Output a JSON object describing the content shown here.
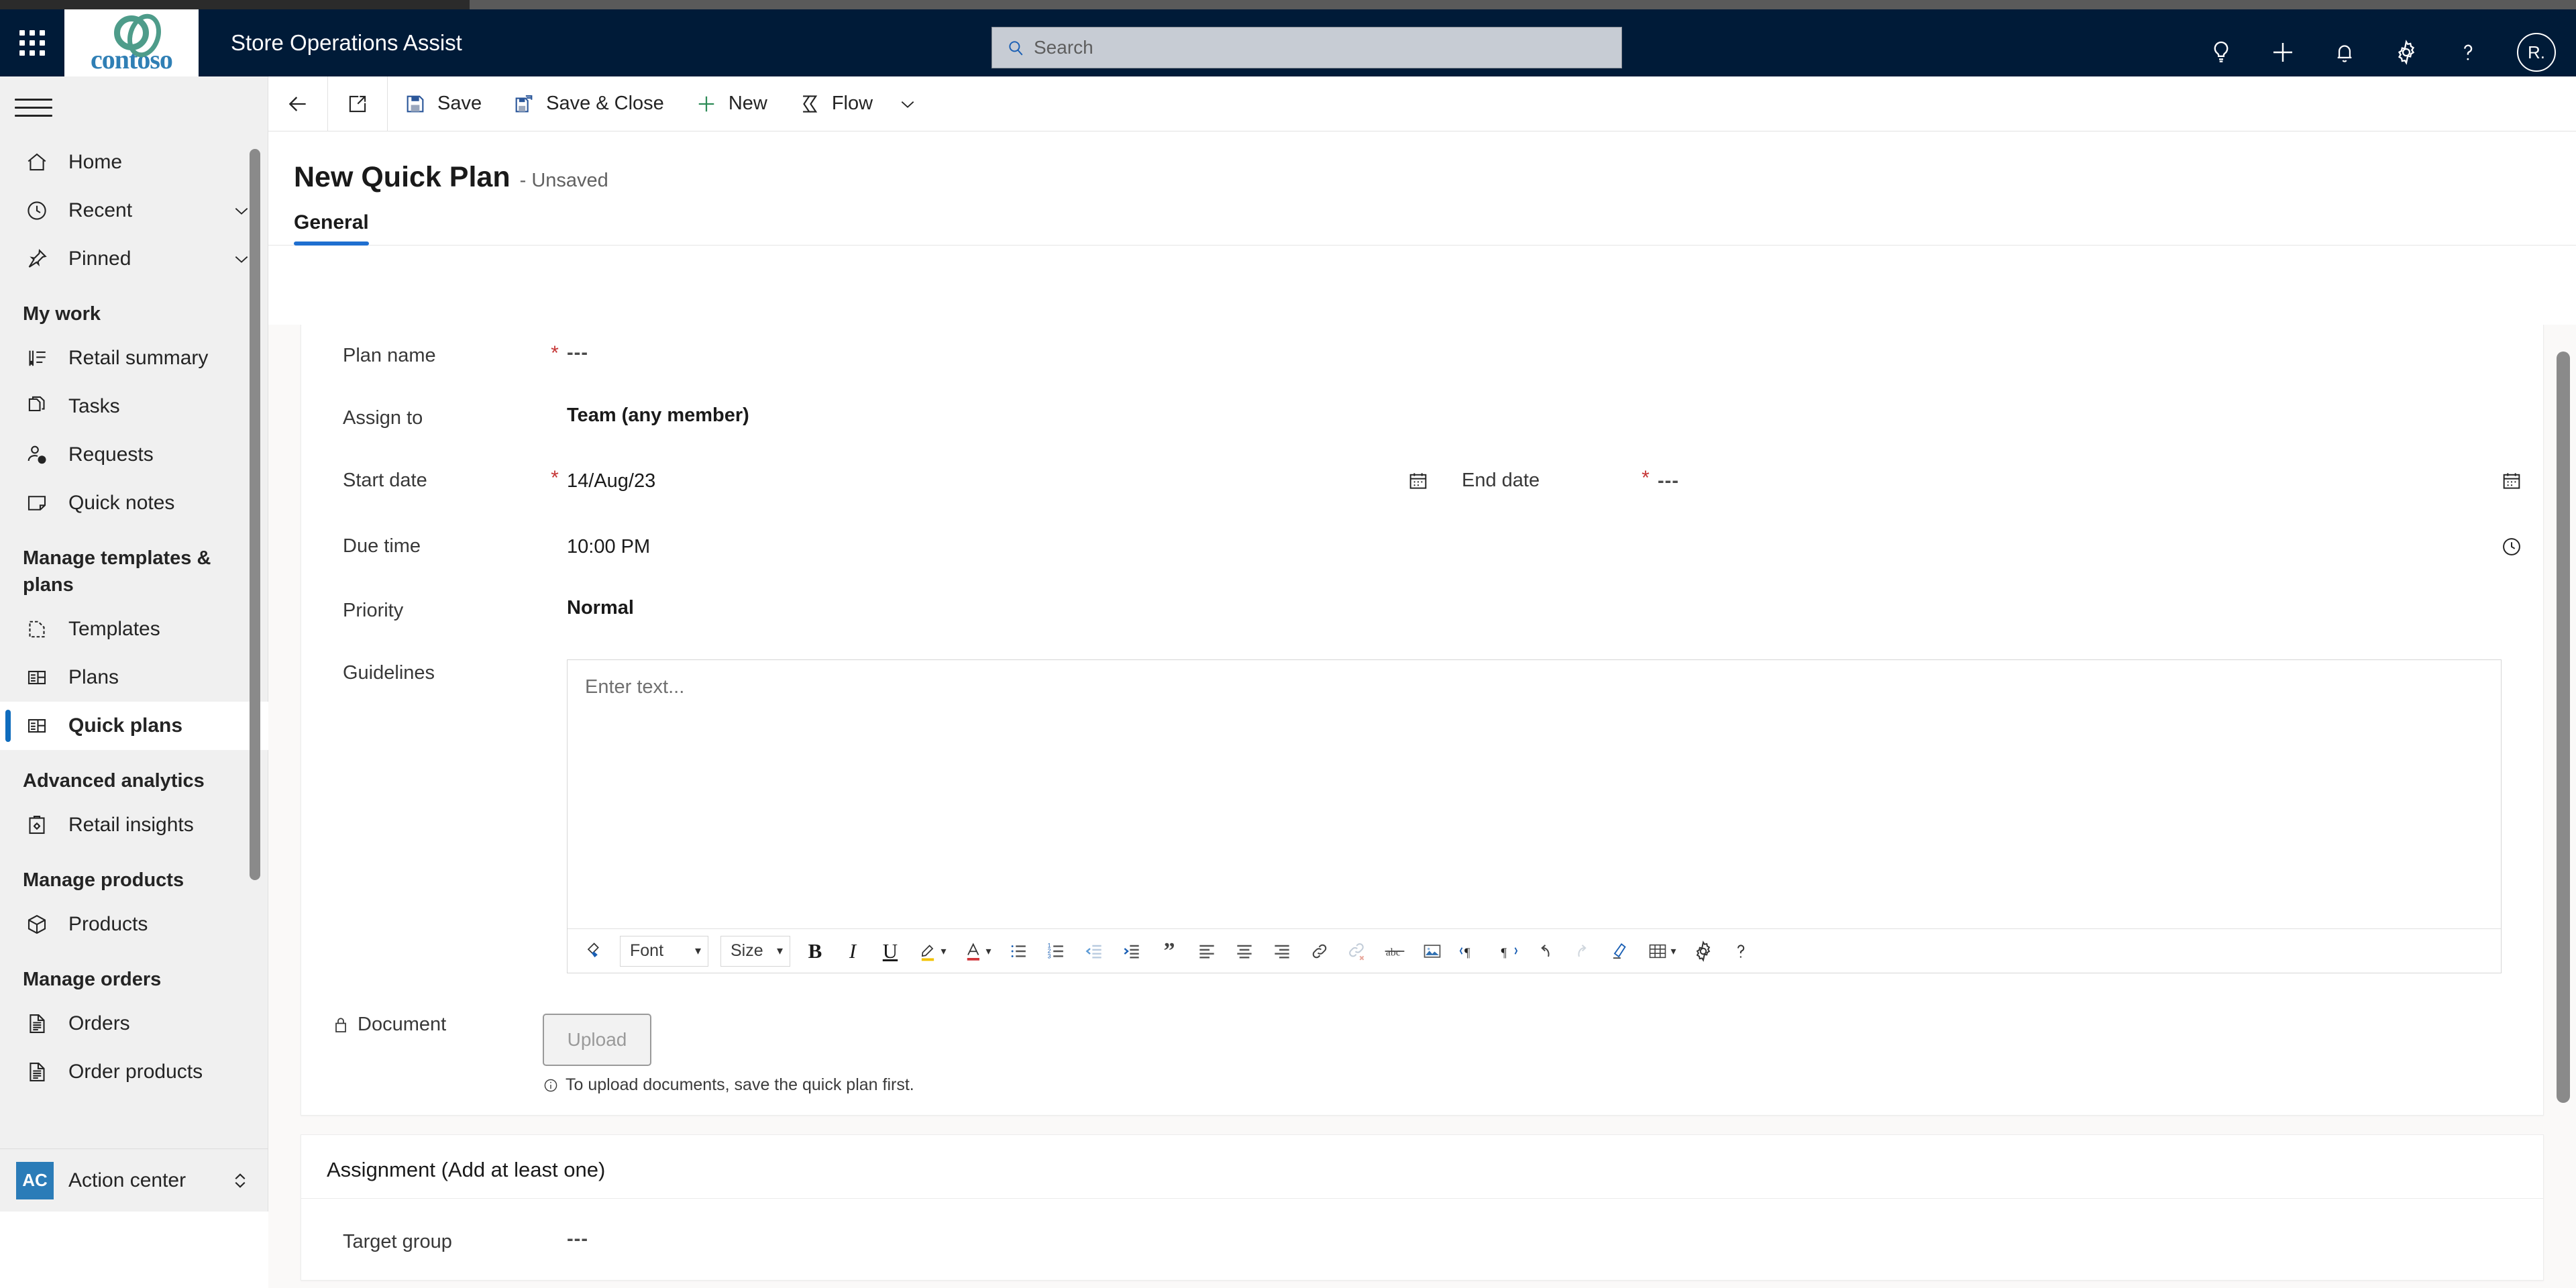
{
  "header": {
    "app_title": "Store Operations Assist",
    "brand_name": "contoso",
    "waffle_label": "App launcher",
    "search": {
      "placeholder": "Search",
      "value": ""
    },
    "actions": [
      {
        "name": "insights-lightbulb-icon",
        "label": "Insights"
      },
      {
        "name": "quick-create-plus-icon",
        "label": "Quick create"
      },
      {
        "name": "notifications-bell-icon",
        "label": "Notifications"
      },
      {
        "name": "settings-gear-icon",
        "label": "Settings"
      },
      {
        "name": "help-question-icon",
        "label": "Help"
      }
    ],
    "avatar_initials": "R."
  },
  "sidebar": {
    "items": [
      {
        "label": "Home",
        "icon": "home-icon",
        "type": "item"
      },
      {
        "label": "Recent",
        "icon": "clock-icon",
        "type": "expand"
      },
      {
        "label": "Pinned",
        "icon": "pin-icon",
        "type": "expand"
      },
      {
        "label": "My work",
        "type": "group"
      },
      {
        "label": "Retail summary",
        "icon": "chart-icon",
        "type": "item"
      },
      {
        "label": "Tasks",
        "icon": "documents-icon",
        "type": "item"
      },
      {
        "label": "Requests",
        "icon": "person-question-icon",
        "type": "item"
      },
      {
        "label": "Quick notes",
        "icon": "note-icon",
        "type": "item"
      },
      {
        "label": "Manage templates & plans",
        "type": "group"
      },
      {
        "label": "Templates",
        "icon": "template-icon",
        "type": "item"
      },
      {
        "label": "Plans",
        "icon": "grid-panel-icon",
        "type": "item"
      },
      {
        "label": "Quick plans",
        "icon": "grid-panel-icon",
        "type": "item",
        "active": true
      },
      {
        "label": "Advanced analytics",
        "type": "group"
      },
      {
        "label": "Retail insights",
        "icon": "clipboard-gear-icon",
        "type": "item"
      },
      {
        "label": "Manage products",
        "type": "group"
      },
      {
        "label": "Products",
        "icon": "box-icon",
        "type": "item"
      },
      {
        "label": "Manage orders",
        "type": "group"
      },
      {
        "label": "Orders",
        "icon": "order-doc-icon",
        "type": "item"
      },
      {
        "label": "Order products",
        "icon": "order-doc-icon",
        "type": "item"
      }
    ],
    "footer": {
      "badge": "AC",
      "label": "Action center"
    },
    "active_accent": "#0f6cbd"
  },
  "commandbar": {
    "back_label": "Back",
    "popout_label": "Open in new window",
    "buttons": [
      {
        "label": "Save",
        "icon": "save-icon"
      },
      {
        "label": "Save & Close",
        "icon": "save-close-icon"
      },
      {
        "label": "New",
        "icon": "plus-icon"
      },
      {
        "label": "Flow",
        "icon": "flow-icon"
      }
    ],
    "overflow_label": "More commands"
  },
  "record": {
    "title": "New Quick Plan",
    "status": "- Unsaved"
  },
  "tabs": [
    {
      "label": "General",
      "active": true
    }
  ],
  "form": {
    "fields": [
      {
        "label": "Plan name",
        "required": true,
        "value": "---",
        "style": "muted"
      },
      {
        "label": "Assign to",
        "required": false,
        "value": "Team (any member)",
        "style": "bold"
      },
      {
        "label": "Start date",
        "required": true,
        "value": "14/Aug/23",
        "style": "plain",
        "trailing_icon": "calendar-icon"
      },
      {
        "label": "End date",
        "required": true,
        "value": "---",
        "style": "muted",
        "trailing_icon": "calendar-icon"
      },
      {
        "label": "Due time",
        "required": false,
        "value": "10:00 PM",
        "style": "plain",
        "trailing_icon": "clock-icon"
      },
      {
        "label": "Priority",
        "required": false,
        "value": "Normal",
        "style": "bold"
      }
    ],
    "guidelines": {
      "label": "Guidelines",
      "placeholder": "Enter text...",
      "value": "",
      "toolbar": {
        "font_label": "Font",
        "size_label": "Size",
        "buttons": [
          "format-painter-icon",
          "bold-icon",
          "italic-icon",
          "underline-icon",
          "highlight-color-icon",
          "font-color-icon",
          "bulleted-list-icon",
          "numbered-list-icon",
          "decrease-indent-icon",
          "increase-indent-icon",
          "blockquote-icon",
          "align-left-icon",
          "align-center-icon",
          "align-right-icon",
          "insert-link-icon",
          "remove-link-icon",
          "strikethrough-icon",
          "insert-image-icon",
          "ltr-direction-icon",
          "rtl-direction-icon",
          "undo-icon",
          "redo-icon",
          "clear-format-icon",
          "insert-table-icon",
          "editor-settings-icon",
          "editor-help-icon"
        ]
      }
    },
    "document": {
      "label": "Document",
      "locked": true,
      "upload_label": "Upload",
      "hint": "To upload documents, save the quick plan first."
    }
  },
  "assignment": {
    "section_title": "Assignment (Add at least one)",
    "fields": [
      {
        "label": "Target group",
        "required": false,
        "value": "---"
      }
    ]
  }
}
